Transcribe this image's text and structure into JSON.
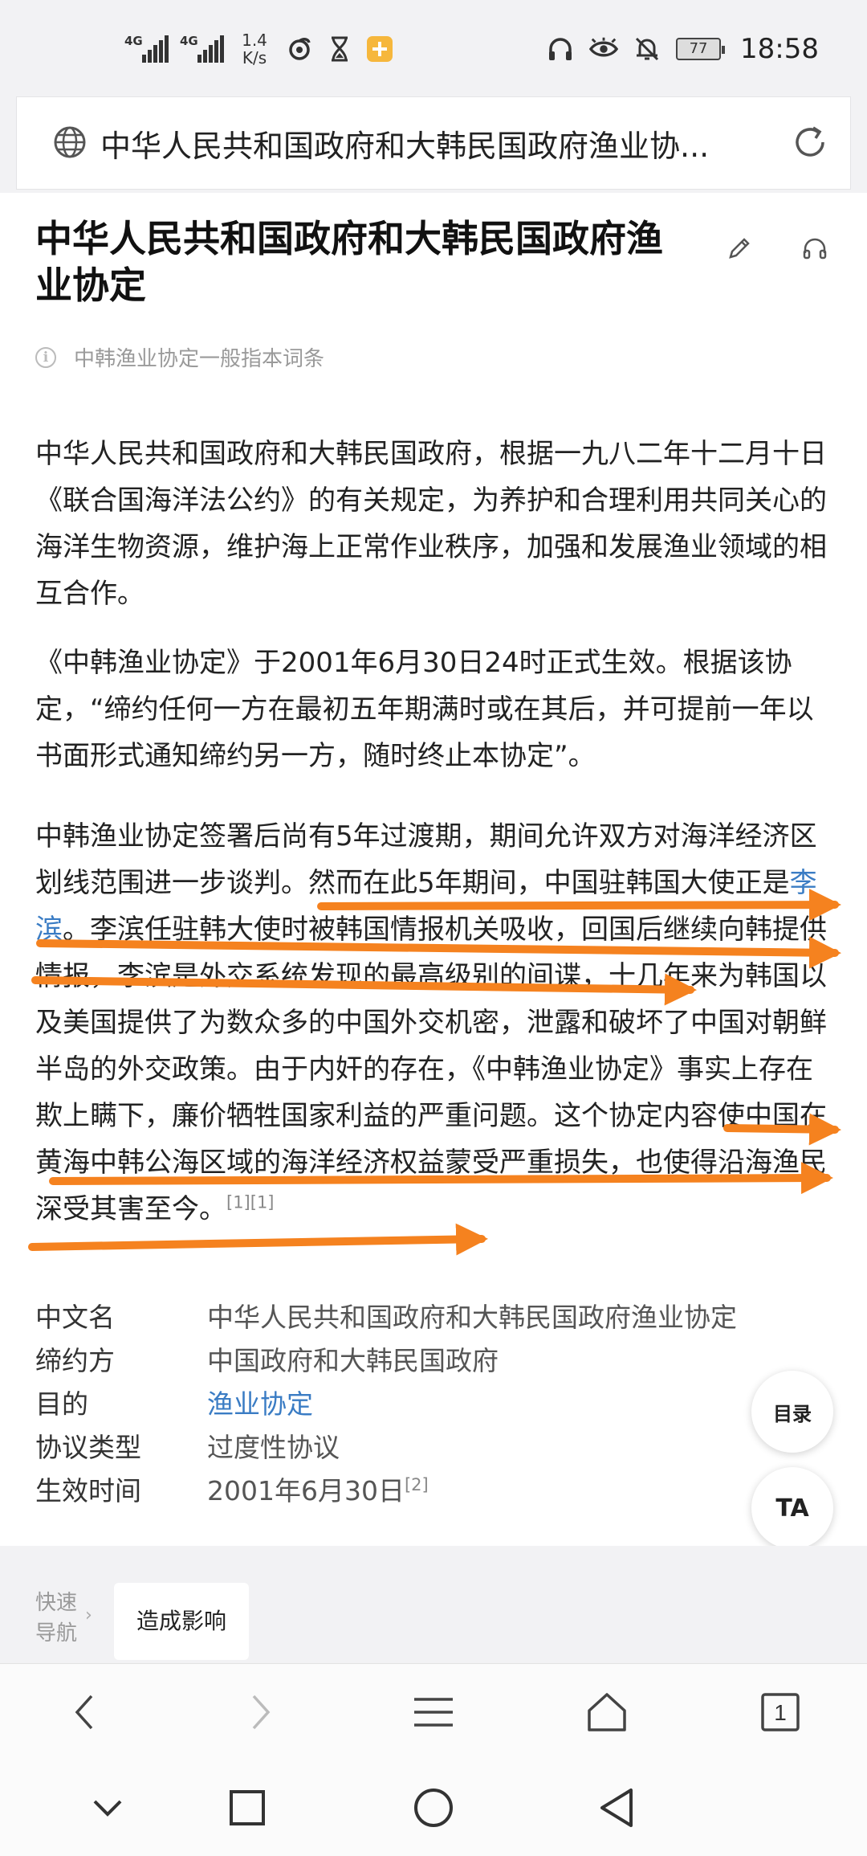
{
  "status_bar": {
    "network_1": "4G",
    "network_2": "4G",
    "speed_value": "1.4",
    "speed_unit": "K/s",
    "battery": "77",
    "time": "18:58"
  },
  "url_bar": {
    "title": "中华人民共和国政府和大韩民国政府渔业协..."
  },
  "article": {
    "title": "中华人民共和国政府和大韩民国政府渔业协定",
    "notice": "中韩渔业协定一般指本词条",
    "p1": "中华人民共和国政府和大韩民国政府，根据一九八二年十二月十日《联合国海洋法公约》的有关规定，为养护和合理利用共同关心的海洋生物资源，维护海上正常作业秩序，加强和发展渔业领域的相互合作。",
    "p2": "《中韩渔业协定》于2001年6月30日24时正式生效。根据该协定，“缔约任何一方在最初五年期满时或在其后，并可提前一年以书面形式通知缔约另一方，随时终止本协定”。",
    "p3_a": "中韩渔业协定签署后尚有5年过渡期，期间允许双方对海洋经济区划线范围进一步谈判。然而在此5年期间，中国驻韩国大使正是",
    "p3_link": "李滨",
    "p3_b": "。李滨任驻韩大使时被韩国情报机关吸收，回国后继续向韩提供情报，李滨是外交系统发现的最高级别的间谍，十几年来为韩国以及美国提供了为数众多的中国外交机密，泄露和破坏了中国对朝鲜半岛的外交政策。由于内奸的存在，《中韩渔业协定》事实上存在欺上瞒下，廉价牺牲国家利益的严重问题。这个协定内容使中国在黄海中韩公海区域的海洋经济权益蒙受严重损失，也使得沿海渔民深受其害至今。",
    "p3_ref": "[1][1]"
  },
  "infobox": {
    "rows": [
      {
        "key": "中文名",
        "value": "中华人民共和国政府和大韩民国政府渔业协定"
      },
      {
        "key": "缔约方",
        "value": "中国政府和大韩民国政府"
      },
      {
        "key": "目的",
        "value": "渔业协定"
      },
      {
        "key": "协议类型",
        "value": "过度性协议"
      },
      {
        "key": "生效时间",
        "value": "2001年6月30日"
      }
    ],
    "ref_2": "[2]"
  },
  "floating": {
    "toc": "目录",
    "ta": "TA"
  },
  "quick_nav": {
    "label_1": "快速",
    "label_2": "导航",
    "arrow": "›",
    "chip": "造成影响"
  },
  "toolbar": {
    "tab_count": "1"
  },
  "colors": {
    "link": "#3a7cc4",
    "arrow": "#f5821f"
  }
}
